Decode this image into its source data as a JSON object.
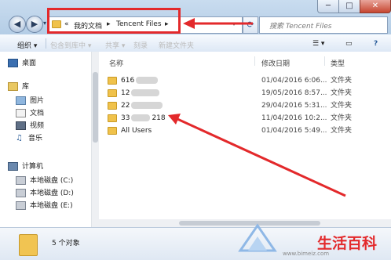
{
  "window": {
    "min": "─",
    "max": "□",
    "close": "✕"
  },
  "nav": {
    "back": "◀",
    "forward": "▶",
    "dropdown": "▾"
  },
  "address": {
    "prefix": "«",
    "crumb1": "我的文档",
    "sep": "▸",
    "crumb2": "Tencent Files",
    "sep2": "▸",
    "dropdown": "▾"
  },
  "refresh": "⟳",
  "search": {
    "placeholder": "搜索 Tencent Files"
  },
  "toolbar": {
    "organize": "组织 ▾",
    "include": "包含到库中 ▾",
    "share": "共享 ▾",
    "burn": "刻录",
    "new_folder": "新建文件夹",
    "view": "☰ ▾",
    "help": "?"
  },
  "sidebar": {
    "desktop": "桌面",
    "libraries": "库",
    "pictures": "图片",
    "documents": "文档",
    "videos": "视频",
    "music": "音乐",
    "computer": "计算机",
    "disk_c": "本地磁盘 (C:)",
    "disk_d": "本地磁盘 (D:)",
    "disk_e": "本地磁盘 (E:)"
  },
  "columns": {
    "name": "名称",
    "modified": "修改日期",
    "type": "类型"
  },
  "files": [
    {
      "name_a": "616",
      "name_b": "",
      "date": "01/04/2016 6:06...",
      "type": "文件夹"
    },
    {
      "name_a": "12",
      "name_b": "",
      "date": "19/05/2016 8:57...",
      "type": "文件夹"
    },
    {
      "name_a": "22",
      "name_b": "",
      "date": "29/04/2016 5:31...",
      "type": "文件夹"
    },
    {
      "name_a": "33",
      "name_b": "218",
      "date": "11/04/2016 10:2...",
      "type": "文件夹"
    },
    {
      "name_a": "All Users",
      "name_b": "",
      "date": "01/04/2016 5:49...",
      "type": "文件夹"
    }
  ],
  "status": {
    "count": "5 个对象"
  },
  "watermark": {
    "brand": "生活百科",
    "url": "www.bimeiz.com"
  },
  "colors": {
    "annotation": "#e3292b",
    "folder": "#f0c24b",
    "accent": "#2a5d9a"
  }
}
